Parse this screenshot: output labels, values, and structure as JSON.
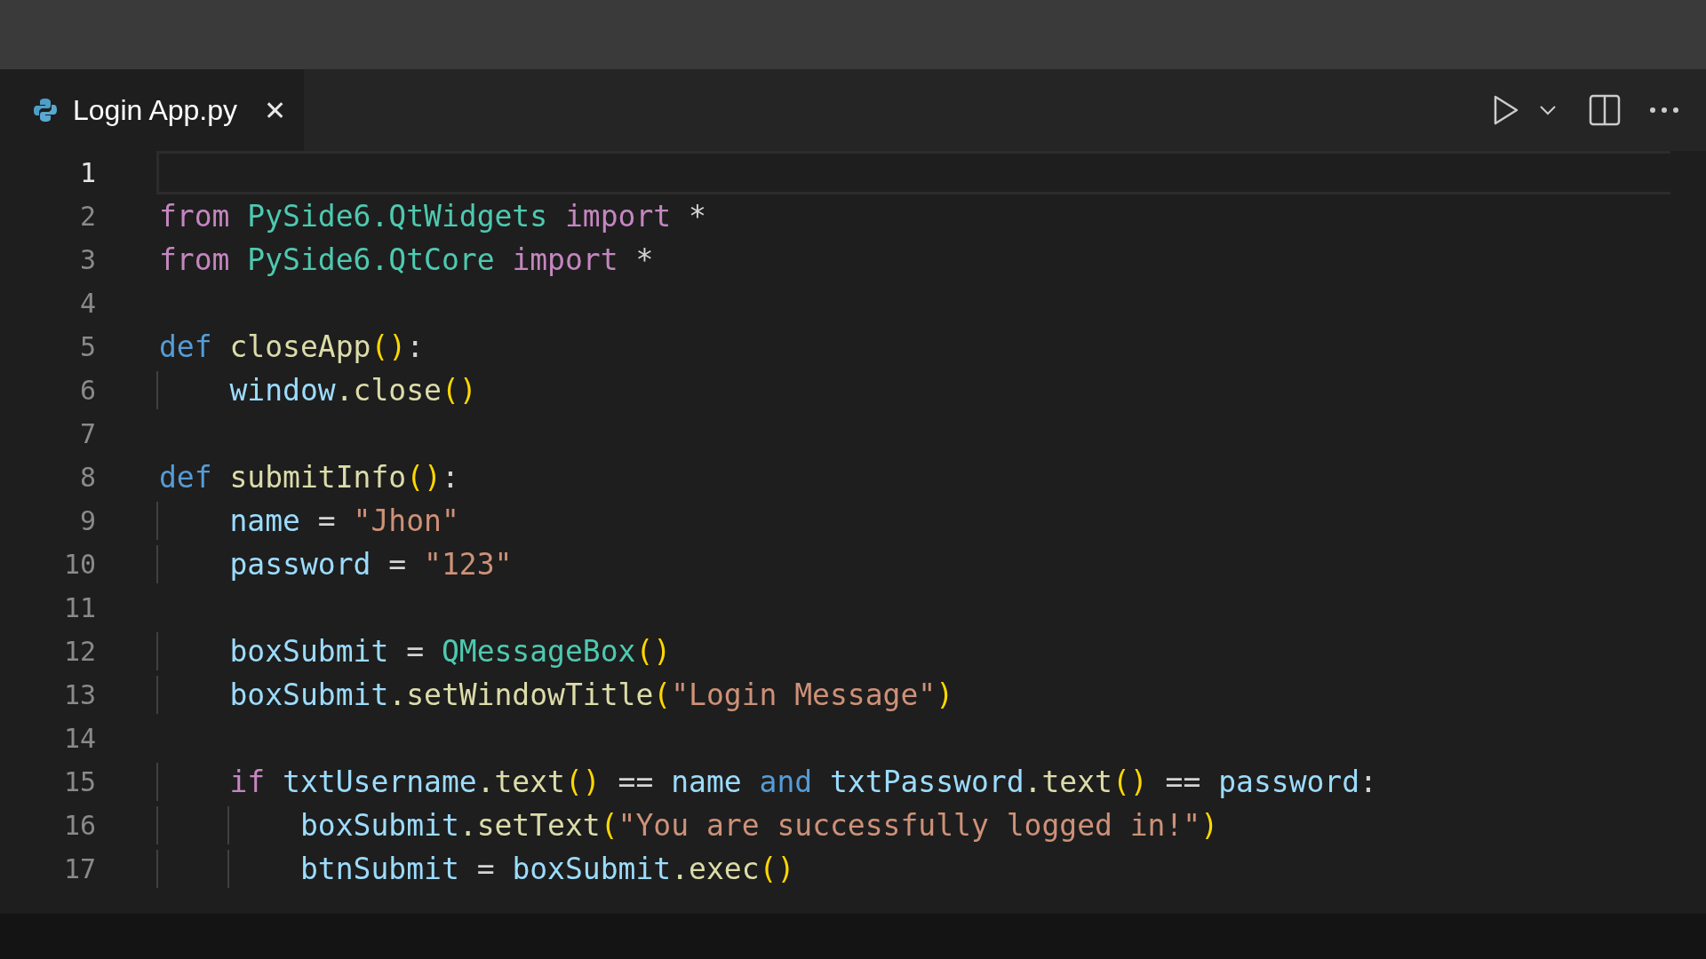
{
  "tabs": [
    {
      "label": "Login App.py",
      "selected": true,
      "close": "✕"
    }
  ],
  "lines": [
    {
      "number": "1",
      "current": true
    },
    {
      "number": "2",
      "current": false,
      "tokens": [
        {
          "text": "from ",
          "color": "#c586c0"
        },
        {
          "text": "PySide6",
          "color": "#4ec9b0"
        },
        {
          "text": ".QtWidgets ",
          "color": "#4ec9b0"
        },
        {
          "text": "import",
          "color": "#c586c0"
        },
        {
          "text": " *",
          "color": "#d4d4d4"
        }
      ]
    },
    {
      "number": "3",
      "current": false,
      "tokens": [
        {
          "text": "from ",
          "color": "#c586c0"
        },
        {
          "text": "PySide6",
          "color": "#4ec9b0"
        },
        {
          "text": ".QtCore ",
          "color": "#4ec9b0"
        },
        {
          "text": "import",
          "color": "#c586c0"
        },
        {
          "text": " *",
          "color": "#d4d4d4"
        }
      ]
    },
    {
      "number": "4",
      "current": false
    },
    {
      "number": "5",
      "current": false,
      "tokens": [
        {
          "text": "def ",
          "color": "#569cd6"
        },
        {
          "text": "closeApp",
          "color": "#dcdcaa"
        },
        {
          "text": "()",
          "color": "#ffd700"
        },
        {
          "text": ":",
          "color": "#d4d4d4"
        }
      ]
    },
    {
      "number": "6",
      "current": false,
      "tokens": [
        {
          "text": "    window",
          "color": "#9cdcfe"
        },
        {
          "text": ".close",
          "color": "#dcdcaa"
        },
        {
          "text": "()",
          "color": "#ffd700"
        }
      ]
    },
    {
      "number": "7",
      "current": false
    },
    {
      "number": "8",
      "current": false,
      "tokens": [
        {
          "text": "def ",
          "color": "#569cd6"
        },
        {
          "text": "submitInfo",
          "color": "#dcdcaa"
        },
        {
          "text": "()",
          "color": "#ffd700"
        },
        {
          "text": ":",
          "color": "#d4d4d4"
        }
      ]
    },
    {
      "number": "9",
      "current": false,
      "tokens": [
        {
          "text": "    name",
          "color": "#9cdcfe"
        },
        {
          "text": " = ",
          "color": "#d4d4d4"
        },
        {
          "text": "\"Jhon\"",
          "color": "#ce9178"
        }
      ]
    },
    {
      "number": "10",
      "current": false,
      "tokens": [
        {
          "text": "    password",
          "color": "#9cdcfe"
        },
        {
          "text": " = ",
          "color": "#d4d4d4"
        },
        {
          "text": "\"123\"",
          "color": "#ce9178"
        }
      ]
    },
    {
      "number": "11",
      "current": false
    },
    {
      "number": "12",
      "current": false,
      "tokens": [
        {
          "text": "    boxSubmit",
          "color": "#9cdcfe"
        },
        {
          "text": " = ",
          "color": "#d4d4d4"
        },
        {
          "text": "QMessageBox",
          "color": "#4ec9b0"
        },
        {
          "text": "()",
          "color": "#ffd700"
        }
      ]
    },
    {
      "number": "13",
      "current": false,
      "tokens": [
        {
          "text": "    boxSubmit",
          "color": "#9cdcfe"
        },
        {
          "text": ".setWindowTitle",
          "color": "#dcdcaa"
        },
        {
          "text": "(",
          "color": "#ffd700"
        },
        {
          "text": "\"Login Message\"",
          "color": "#ce9178"
        },
        {
          "text": ")",
          "color": "#ffd700"
        }
      ]
    },
    {
      "number": "14",
      "current": false
    },
    {
      "number": "15",
      "current": false,
      "tokens": [
        {
          "text": "    if ",
          "color": "#c586c0"
        },
        {
          "text": "txtUsername",
          "color": "#9cdcfe"
        },
        {
          "text": ".text",
          "color": "#dcdcaa"
        },
        {
          "text": "()",
          "color": "#ffd700"
        },
        {
          "text": " == ",
          "color": "#d4d4d4"
        },
        {
          "text": "name ",
          "color": "#9cdcfe"
        },
        {
          "text": "and ",
          "color": "#569cd6"
        },
        {
          "text": "txtPassword",
          "color": "#9cdcfe"
        },
        {
          "text": ".text",
          "color": "#dcdcaa"
        },
        {
          "text": "()",
          "color": "#ffd700"
        },
        {
          "text": " == ",
          "color": "#d4d4d4"
        },
        {
          "text": "password",
          "color": "#9cdcfe"
        },
        {
          "text": ":",
          "color": "#d4d4d4"
        }
      ]
    },
    {
      "number": "16",
      "current": false,
      "tokens": [
        {
          "text": "        boxSubmit",
          "color": "#9cdcfe"
        },
        {
          "text": ".setText",
          "color": "#dcdcaa"
        },
        {
          "text": "(",
          "color": "#ffd700"
        },
        {
          "text": "\"You are successfully logged in!\"",
          "color": "#ce9178"
        },
        {
          "text": ")",
          "color": "#ffd700"
        }
      ]
    },
    {
      "number": "17",
      "current": false,
      "tokens": [
        {
          "text": "        btnSubmit",
          "color": "#9cdcfe"
        },
        {
          "text": " = ",
          "color": "#d4d4d4"
        },
        {
          "text": "boxSubmit",
          "color": "#9cdcfe"
        },
        {
          "text": ".exec",
          "color": "#dcdcaa"
        },
        {
          "text": "()",
          "color": "#ffd700"
        }
      ]
    }
  ]
}
